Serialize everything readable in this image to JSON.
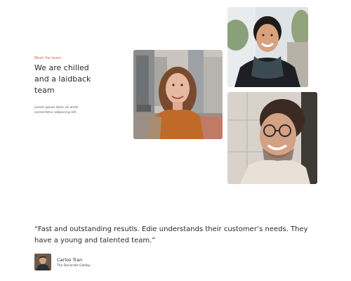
{
  "intro": {
    "eyebrow": "Meet the team",
    "heading": "We are chilled and a laidback team",
    "body": "Lorem ipsum dolor sit amet, consectetur adipiscing elit."
  },
  "photos": [
    {
      "subject": "woman-smiling-city-street"
    },
    {
      "subject": "man-with-scarf-smiling"
    },
    {
      "subject": "man-with-glasses-laughing"
    }
  ],
  "testimonial": {
    "quote": "“Fast and outstanding resutls. Edie understands their customer’s needs. They have a young and talented team.”",
    "author_name": "Carlos Tran",
    "author_role": "The Decorate Gatsby"
  },
  "colors": {
    "accent": "#c96a4a",
    "text": "#2a2a2a",
    "background": "#ffffff"
  }
}
